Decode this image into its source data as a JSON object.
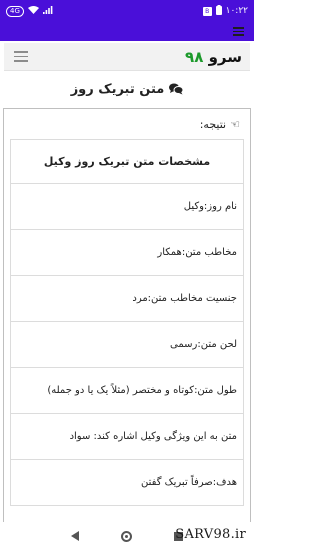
{
  "status_bar": {
    "time": "۱۰:۲۲",
    "left_badge": "4G",
    "battery_label": "B"
  },
  "site": {
    "brand_text": "سرو",
    "brand_number": "۹۸"
  },
  "page": {
    "title": "متن تبریک روز"
  },
  "result": {
    "heading": "نتیجه:",
    "table_title": "مشخصات متن تبریک روز وکیل",
    "rows": [
      "نام روز:وکیل",
      "مخاطب متن:همکار",
      "جنسیت مخاطب متن:مرد",
      "لحن متن:رسمی",
      "طول متن:کوتاه و مختصر (مثلاً یک یا دو جمله)",
      "متن به این ویژگی وکیل اشاره کند: سواد",
      "هدف:صرفاً تبریک گفتن"
    ]
  },
  "watermark": "SARV98.ir",
  "colors": {
    "status_bar": "#4a0fd9",
    "brand_number": "#1d9a2c"
  },
  "icons": {
    "menu": "hamburger-icon",
    "title": "chat-bubbles-icon",
    "heading": "hand-pointer-icon"
  }
}
